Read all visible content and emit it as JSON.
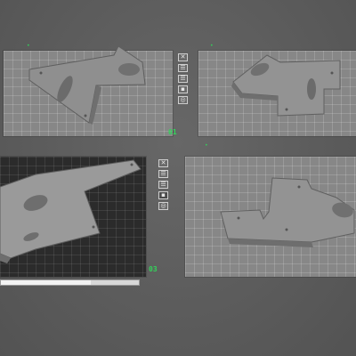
{
  "plates": [
    {
      "number": "01",
      "toolbar": [
        "close-icon",
        "layers-icon",
        "layers-icon",
        "lock-icon",
        "settings-icon"
      ]
    },
    {
      "number": "02"
    },
    {
      "number": "03",
      "toolbar": [
        "close-icon",
        "layers-icon",
        "layers-icon",
        "lock-icon",
        "settings-icon"
      ]
    },
    {
      "number": "04"
    }
  ],
  "toolbar_glyphs": {
    "close-icon": "✕",
    "layers-icon": "☰",
    "lock-icon": "▪",
    "settings-icon": "◎"
  },
  "colors": {
    "accent": "#32d35a",
    "plate": "#878787",
    "active_plate": "#2b2b2b",
    "model": "#8a8a8a"
  },
  "progress": {
    "label": "",
    "fraction": 0.65
  }
}
